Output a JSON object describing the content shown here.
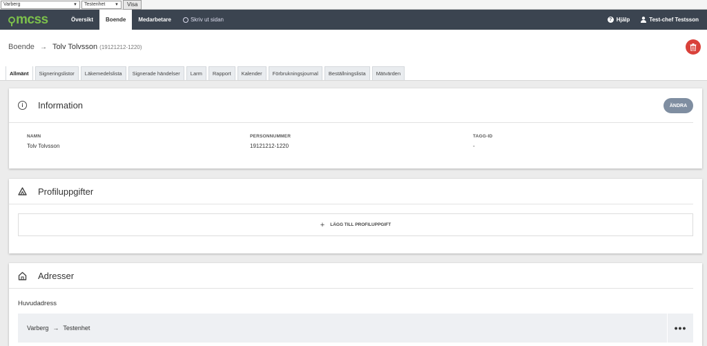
{
  "topbar": {
    "unit_select": "Varberg",
    "subunit_select": "Testenhet",
    "show_button": "Visa"
  },
  "nav": {
    "logo": "mcss",
    "items": [
      {
        "label": "Översikt",
        "active": false
      },
      {
        "label": "Boende",
        "active": true
      },
      {
        "label": "Medarbetare",
        "active": false
      }
    ],
    "print_label": "Skriv ut sidan",
    "help_label": "Hjälp",
    "user_label": "Test-chef Testsson",
    "colors": {
      "bar": "#3b4450",
      "logo": "#7cc04b"
    }
  },
  "breadcrumb": {
    "parent": "Boende",
    "current": "Tolv Tolvsson",
    "personnummer": "(19121212-1220)"
  },
  "tabs": [
    {
      "label": "Allmänt",
      "active": true
    },
    {
      "label": "Signeringslistor"
    },
    {
      "label": "Läkemedelslista"
    },
    {
      "label": "Signerade händelser"
    },
    {
      "label": "Larm"
    },
    {
      "label": "Rapport"
    },
    {
      "label": "Kalender"
    },
    {
      "label": "Förbrukningsjournal"
    },
    {
      "label": "Beställningslista"
    },
    {
      "label": "Mätvärden"
    }
  ],
  "information": {
    "title": "Information",
    "edit_button": "ÄNDRA",
    "fields": [
      {
        "label": "NAMN",
        "value": "Tolv Tolvsson"
      },
      {
        "label": "PERSONNUMMER",
        "value": "19121212-1220"
      },
      {
        "label": "TAGG-ID",
        "value": "-"
      }
    ]
  },
  "profile": {
    "title": "Profiluppgifter",
    "add_label": "LÄGG TILL PROFILUPPGIFT"
  },
  "addresses": {
    "title": "Adresser",
    "subtitle": "Huvudadress",
    "row": {
      "from": "Varberg",
      "to": "Testenhet"
    },
    "more": "•••"
  },
  "colors": {
    "delete": "#d9413a",
    "edit_button": "#7f8ea1"
  }
}
